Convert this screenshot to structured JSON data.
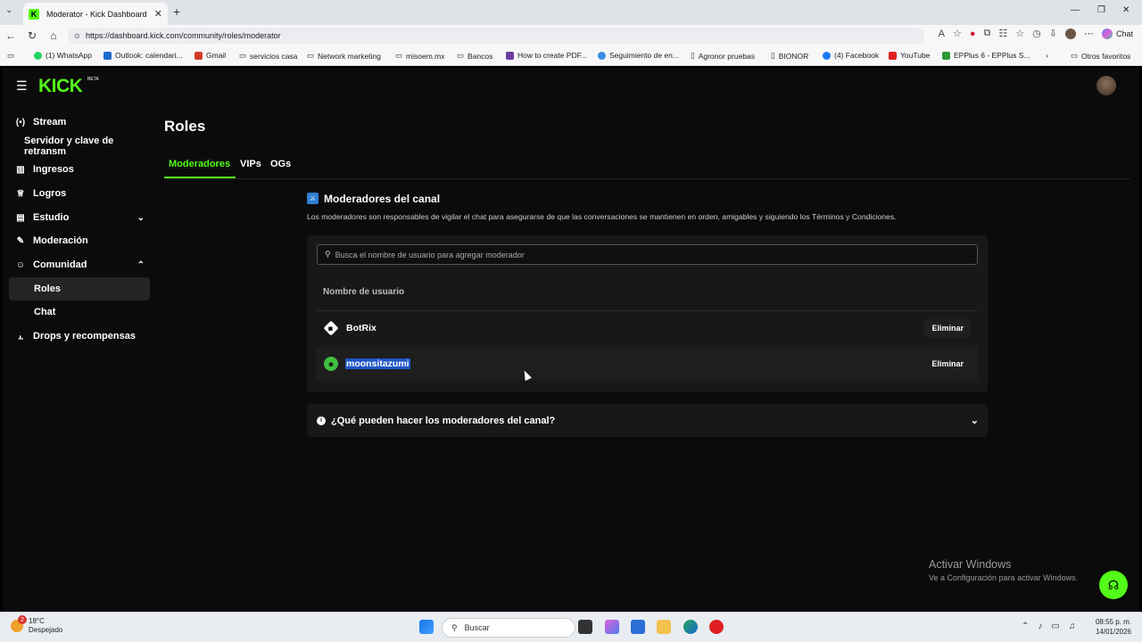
{
  "browser": {
    "tab_title": "Moderator - Kick Dashboard",
    "url": "https://dashboard.kick.com/community/roles/moderator",
    "chat_label": "Chat",
    "bookmarks": [
      "(1) WhatsApp",
      "Outlook: calendari...",
      "Gmail",
      "servicios casa",
      "Network marketing",
      "misoem.mx",
      "Bancos",
      "How to create PDF...",
      "Seguimiento de en...",
      "Agronor pruebas",
      "BIONOR",
      "(4) Facebook",
      "YouTube",
      "EPPlus 6 - EPPlus S...",
      "Otros favoritos"
    ]
  },
  "header": {
    "logo": "KICK",
    "beta": "BETA"
  },
  "sidebar": {
    "items": [
      {
        "label": "Stream",
        "icon": "broadcast-icon"
      },
      {
        "label": "Servidor y clave de retransm"
      },
      {
        "label": "Ingresos",
        "icon": "chart-icon"
      },
      {
        "label": "Logros",
        "icon": "trophy-icon"
      },
      {
        "label": "Estudio",
        "icon": "studio-icon"
      },
      {
        "label": "Moderación",
        "icon": "wrench-icon"
      },
      {
        "label": "Comunidad",
        "icon": "community-icon"
      },
      {
        "label": "Roles"
      },
      {
        "label": "Chat"
      },
      {
        "label": "Drops y recompensas",
        "icon": "drops-icon"
      }
    ]
  },
  "main": {
    "title": "Roles",
    "tabs": [
      "Moderadores",
      "VIPs",
      "OGs"
    ],
    "section_title": "Moderadores del canal",
    "section_desc": "Los moderadores son responsables de vigilar el chat para asegurarse de que las conversaciones se mantienen en orden, amigables y siguiendo los Términos y Condiciones.",
    "search_placeholder": "Busca el nombre de usuario para agregar moderador",
    "column_header": "Nombre de usuario",
    "moderators": [
      {
        "name": "BotRix",
        "action": "Eliminar"
      },
      {
        "name": "moonsitazumi",
        "action": "Eliminar"
      }
    ],
    "faq": "¿Qué pueden hacer los moderadores del canal?"
  },
  "watermark": {
    "line1": "Activar Windows",
    "line2": "Ve a Configuración para activar Windows."
  },
  "taskbar": {
    "temp": "18°C",
    "weather": "Despejado",
    "weather_badge": "2",
    "search": "Buscar",
    "time": "08:55 p. m.",
    "date": "14/01/2026"
  },
  "colors": {
    "accent": "#53fc18",
    "background": "#0b0b0b",
    "card": "#181818"
  }
}
